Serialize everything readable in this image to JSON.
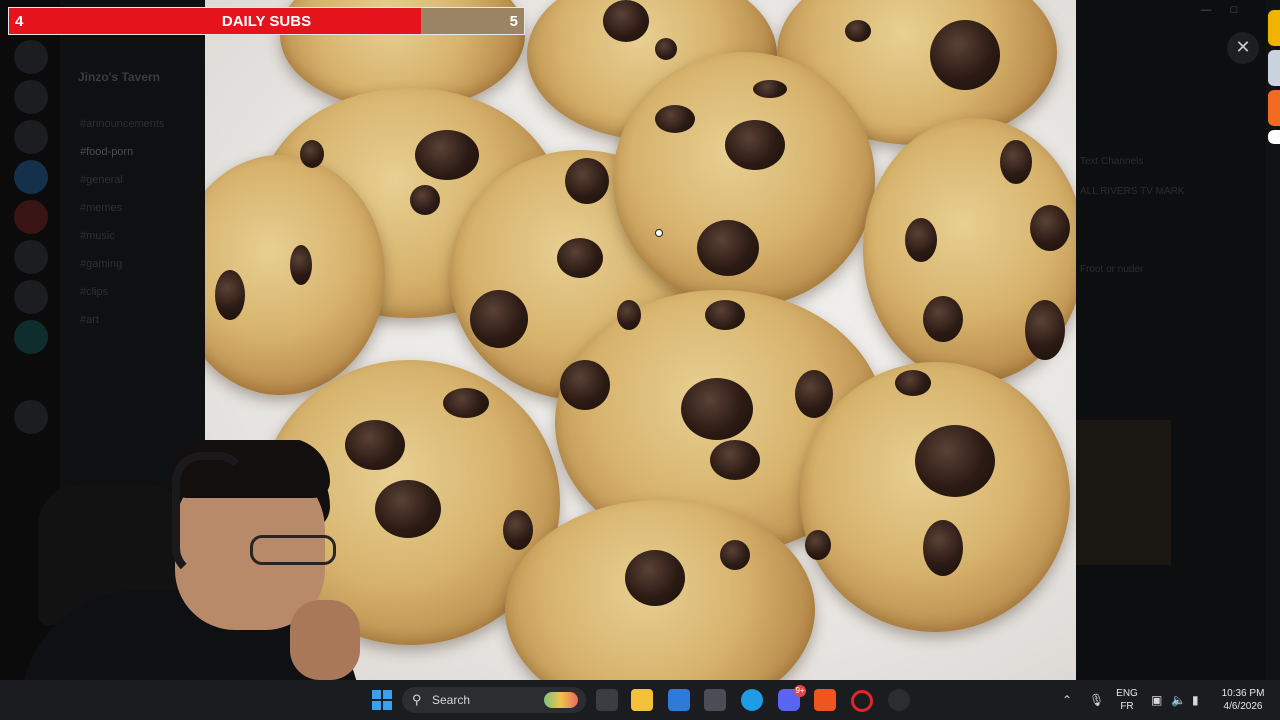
{
  "sub_goal": {
    "current": "4",
    "title": "DAILY SUBS",
    "target": "5",
    "progress_fraction": 0.8,
    "fill_color": "#e5141c",
    "track_color": "#9a8463"
  },
  "discord": {
    "server_name": "Jinzo's Tavern",
    "channels": [
      "#announcements",
      "#food-porn",
      "#general",
      "#memes",
      "#music",
      "#gaming",
      "#clips",
      "#art"
    ],
    "active_channel": "#food-porn",
    "right_panel": {
      "heading": "Text Channels",
      "item_1": "ALL RIVERS TV MARK",
      "item_2": "Froot or nuder"
    }
  },
  "viewer": {
    "close_icon": "close-icon",
    "content": "photo of chocolate chip cookies"
  },
  "taskbar": {
    "search_placeholder": "Search",
    "language_top": "ENG",
    "language_bottom": "FR",
    "time": "10:36 PM",
    "date": "4/6/2026",
    "discord_badge": "9+",
    "icons": [
      "windows-start-icon",
      "search-icon",
      "file-explorer-icon",
      "folder-icon",
      "store-icon",
      "app-icon",
      "edge-icon",
      "discord-icon",
      "brave-icon",
      "opera-icon",
      "obs-icon"
    ]
  }
}
